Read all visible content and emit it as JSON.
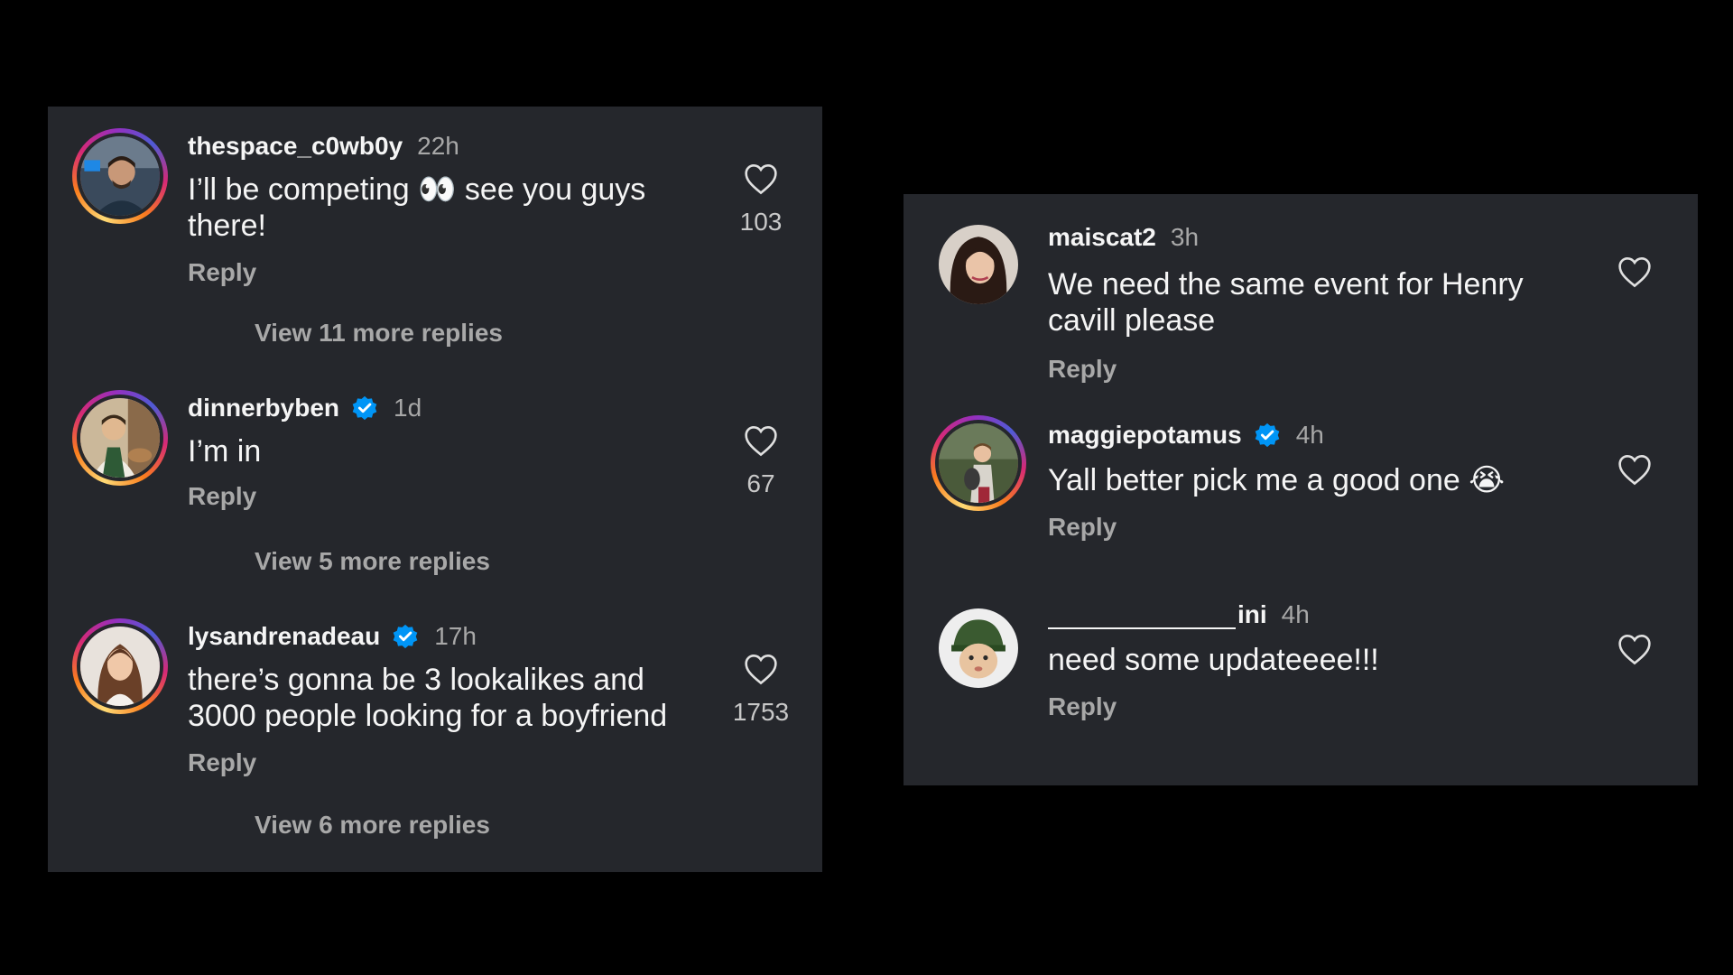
{
  "left_panel": {
    "comments": [
      {
        "username": "thespace_c0wb0y",
        "verified": false,
        "time": "22h",
        "text": "I’ll be competing 👀 see you guys there!",
        "reply_label": "Reply",
        "likes": "103",
        "view_more": "View 11 more replies"
      },
      {
        "username": "dinnerbyben",
        "verified": true,
        "time": "1d",
        "text": "I’m in",
        "reply_label": "Reply",
        "likes": "67",
        "view_more": "View 5 more replies"
      },
      {
        "username": "lysandrenadeau",
        "verified": true,
        "time": "17h",
        "text": "there’s gonna be 3 lookalikes and 3000 people looking for a boyfriend",
        "reply_label": "Reply",
        "likes": "1753",
        "view_more": "View 6 more replies"
      }
    ]
  },
  "right_panel": {
    "comments": [
      {
        "username": "maiscat2",
        "verified": false,
        "time": "3h",
        "text": "We need the same event for Henry cavill please",
        "reply_label": "Reply"
      },
      {
        "username": "maggiepotamus",
        "verified": true,
        "time": "4h",
        "text": "Yall better pick me a good one 😭",
        "reply_label": "Reply"
      },
      {
        "username": "ini",
        "verified": false,
        "time": "4h",
        "text": "need some updateeee!!!",
        "reply_label": "Reply"
      }
    ]
  },
  "colors": {
    "background": "#000000",
    "panel": "#25272c",
    "text": "#f5f5f5",
    "muted": "#a8a8a8",
    "verified": "#0095f6"
  },
  "icons": {
    "like": "heart-outline-icon",
    "verified": "verified-badge-icon"
  }
}
